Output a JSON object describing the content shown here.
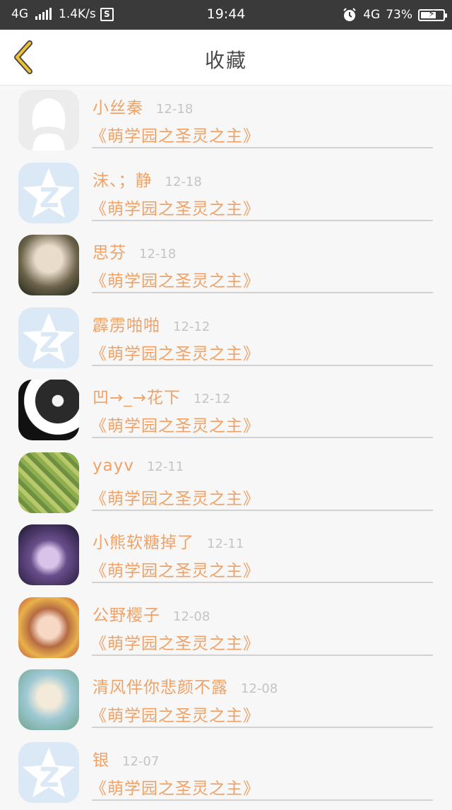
{
  "status_bar": {
    "network_left": "4G",
    "speed": "1.4K/s",
    "s_badge": "S",
    "time": "19:44",
    "network_right": "4G",
    "battery_percent": "73%",
    "battery_level": 0.73
  },
  "header": {
    "title": "收藏",
    "back_icon": "chevron-left-icon",
    "accent_color": "#f0c231"
  },
  "colors": {
    "name": "#f0a266",
    "date": "#c4c4c4",
    "background": "#f7f7f7"
  },
  "items": [
    {
      "name": "小丝秦",
      "date": "12-18",
      "book": "《萌学园之圣灵之主》",
      "avatar": "default-person-avatar"
    },
    {
      "name": "沫、；静",
      "date": "12-18",
      "book": "《萌学园之圣灵之主》",
      "avatar": "qq-default-avatar"
    },
    {
      "name": "思芬",
      "date": "12-18",
      "book": "《萌学园之圣灵之主》",
      "avatar": "photo-avatar"
    },
    {
      "name": "霹雳啪啪",
      "date": "12-12",
      "book": "《萌学园之圣灵之主》",
      "avatar": "qq-default-avatar"
    },
    {
      "name": "凹→_→花下",
      "date": "12-12",
      "book": "《萌学园之圣灵之主》",
      "avatar": "photo-avatar"
    },
    {
      "name": "yayv",
      "date": "12-11",
      "book": "《萌学园之圣灵之主》",
      "avatar": "photo-avatar"
    },
    {
      "name": "小熊软糖掉了",
      "date": "12-11",
      "book": "《萌学园之圣灵之主》",
      "avatar": "anime-avatar"
    },
    {
      "name": "公野樱子",
      "date": "12-08",
      "book": "《萌学园之圣灵之主》",
      "avatar": "anime-avatar"
    },
    {
      "name": "清风伴你悲颜不露",
      "date": "12-08",
      "book": "《萌学园之圣灵之主》",
      "avatar": "anime-avatar"
    },
    {
      "name": "银",
      "date": "12-07",
      "book": "《萌学园之圣灵之主》",
      "avatar": "qq-default-avatar"
    }
  ]
}
